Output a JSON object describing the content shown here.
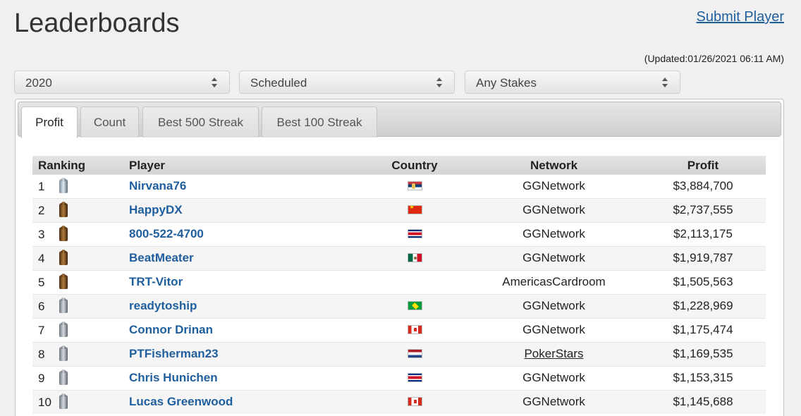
{
  "header": {
    "title": "Leaderboards",
    "submit_label": "Submit Player",
    "updated": "(Updated:01/26/2021 06:11 AM)"
  },
  "filters": {
    "year": "2020",
    "game_type": "Scheduled",
    "stakes": "Any Stakes"
  },
  "tabs": [
    {
      "label": "Profit",
      "active": true
    },
    {
      "label": "Count",
      "active": false
    },
    {
      "label": "Best 500 Streak",
      "active": false
    },
    {
      "label": "Best 100 Streak",
      "active": false
    }
  ],
  "table": {
    "columns": [
      "Ranking",
      "Player",
      "Country",
      "Network",
      "Profit"
    ],
    "rows": [
      {
        "rank": "1",
        "badge": "diamond",
        "player": "Nirvana76",
        "flag": "rs",
        "network": "GGNetwork",
        "network_link": false,
        "profit": "$3,884,700"
      },
      {
        "rank": "2",
        "badge": "bronze",
        "player": "HappyDX",
        "flag": "cn",
        "network": "GGNetwork",
        "network_link": false,
        "profit": "$2,737,555"
      },
      {
        "rank": "3",
        "badge": "bronze",
        "player": "800-522-4700",
        "flag": "cr",
        "network": "GGNetwork",
        "network_link": false,
        "profit": "$2,113,175"
      },
      {
        "rank": "4",
        "badge": "bronze",
        "player": "BeatMeater",
        "flag": "mx",
        "network": "GGNetwork",
        "network_link": false,
        "profit": "$1,919,787"
      },
      {
        "rank": "5",
        "badge": "bronze",
        "player": "TRT-Vitor",
        "flag": "",
        "network": "AmericasCardroom",
        "network_link": false,
        "profit": "$1,505,563"
      },
      {
        "rank": "6",
        "badge": "silver",
        "player": "readytoship",
        "flag": "br",
        "network": "GGNetwork",
        "network_link": false,
        "profit": "$1,228,969"
      },
      {
        "rank": "7",
        "badge": "silver",
        "player": "Connor Drinan",
        "flag": "ca",
        "network": "GGNetwork",
        "network_link": false,
        "profit": "$1,175,474"
      },
      {
        "rank": "8",
        "badge": "silver",
        "player": "PTFisherman23",
        "flag": "nl",
        "network": "PokerStars",
        "network_link": true,
        "profit": "$1,169,535"
      },
      {
        "rank": "9",
        "badge": "silver",
        "player": "Chris Hunichen",
        "flag": "cr",
        "network": "GGNetwork",
        "network_link": false,
        "profit": "$1,153,315"
      },
      {
        "rank": "10",
        "badge": "silver",
        "player": "Lucas Greenwood",
        "flag": "ca",
        "network": "GGNetwork",
        "network_link": false,
        "profit": "$1,145,688"
      }
    ]
  }
}
